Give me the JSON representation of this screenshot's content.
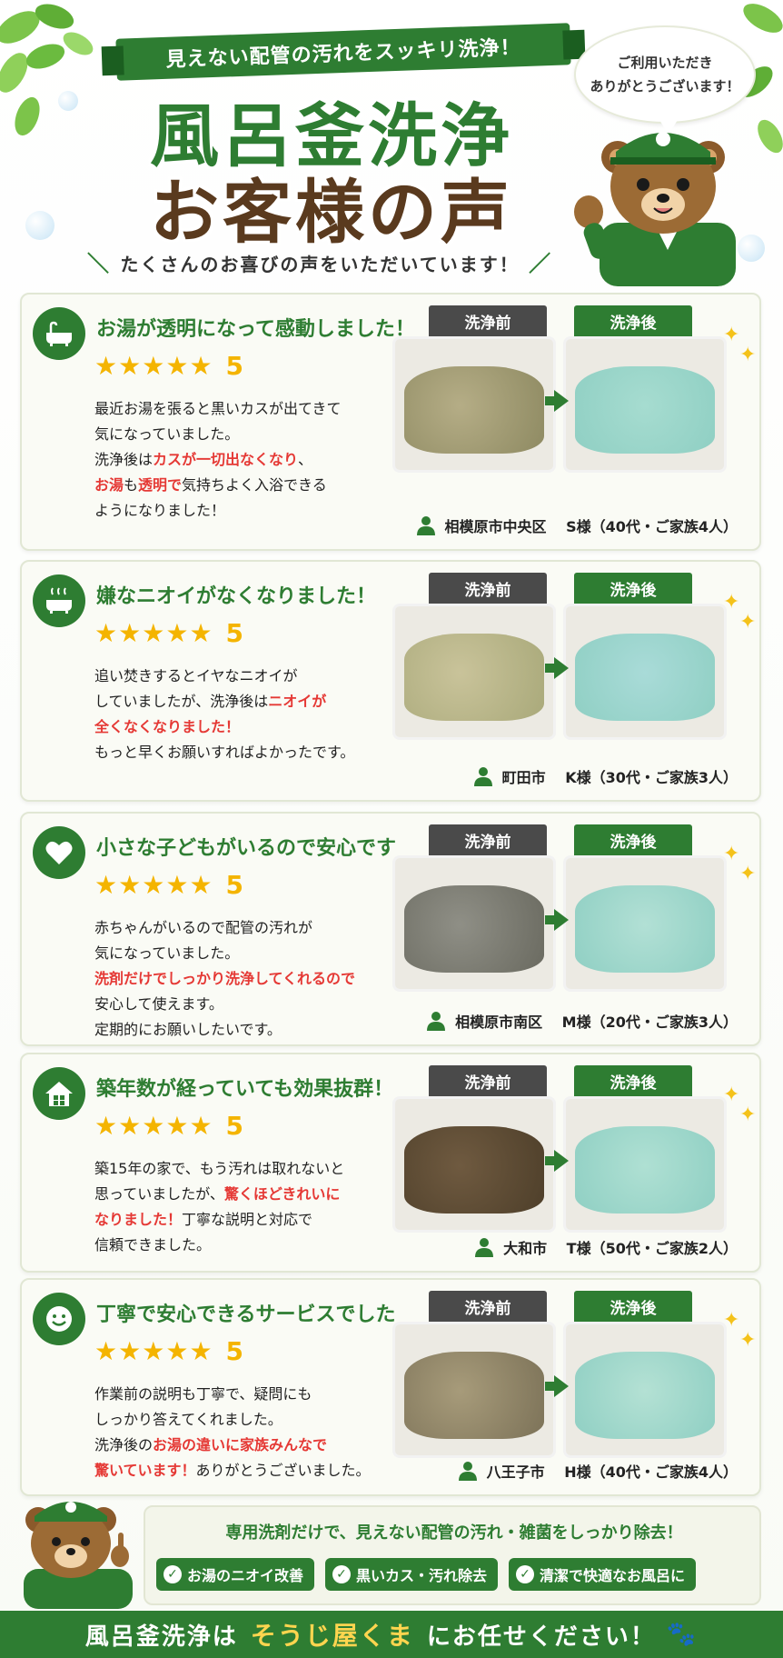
{
  "header": {
    "banner": "見えない配管の汚れをスッキリ洗浄！",
    "title_line1": "風呂釜洗浄",
    "title_line2": "お客様の声",
    "subtitle": "たくさんのお喜びの声をいただいています！",
    "speech_line1": "ご利用いただき",
    "speech_line2": "ありがとうございます！"
  },
  "photo_labels": {
    "before": "洗浄前",
    "after": "洗浄後"
  },
  "rating_star": "★",
  "reviews": [
    {
      "icon": "bathtub-icon",
      "title": "お湯が透明になって感動しました！",
      "rating": "5",
      "parts": [
        {
          "t": "最近お湯を張ると黒いカスが出てきて\n気になっていました。\n洗浄後は",
          "h": false
        },
        {
          "t": "カスが一切出なくなり",
          "h": true
        },
        {
          "t": "、\n",
          "h": false
        },
        {
          "t": "お湯",
          "h": true
        },
        {
          "t": "も",
          "h": false
        },
        {
          "t": "透明で",
          "h": true
        },
        {
          "t": "気持ちよく入浴できる\nようになりました！",
          "h": false
        }
      ],
      "customer": "相模原市中央区　 S様（40代・ご家族4人）"
    },
    {
      "icon": "steaming-bathtub-icon",
      "title": "嫌なニオイがなくなりました！",
      "rating": "5",
      "parts": [
        {
          "t": "追い焚きするとイヤなニオイが\nしていましたが、洗浄後は",
          "h": false
        },
        {
          "t": "ニオイが\n全くなくなりました！",
          "h": true
        },
        {
          "t": "\nもっと早くお願いすればよかったです。",
          "h": false
        }
      ],
      "customer": "町田市　 K様（30代・ご家族3人）"
    },
    {
      "icon": "heart-icon",
      "title": "小さな子どもがいるので安心です",
      "rating": "5",
      "parts": [
        {
          "t": "赤ちゃんがいるので配管の汚れが\n気になっていました。\n",
          "h": false
        },
        {
          "t": "洗剤だけでしっかり洗浄してくれるので",
          "h": true
        },
        {
          "t": "\n安心して使えます。\n定期的にお願いしたいです。",
          "h": false
        }
      ],
      "customer": "相模原市南区　 M様（20代・ご家族3人）"
    },
    {
      "icon": "house-icon",
      "title": "築年数が経っていても効果抜群！",
      "rating": "5",
      "parts": [
        {
          "t": "築15年の家で、もう汚れは取れないと\n思っていましたが、",
          "h": false
        },
        {
          "t": "驚くほどきれいに\nなりました！",
          "h": true
        },
        {
          "t": "丁寧な説明と対応で\n信頼できました。",
          "h": false
        }
      ],
      "customer": "大和市　 T様（50代・ご家族2人）"
    },
    {
      "icon": "smile-icon",
      "title": "丁寧で安心できるサービスでした",
      "rating": "5",
      "parts": [
        {
          "t": "作業前の説明も丁寧で、疑問にも\nしっかり答えてくれました。\n洗浄後の",
          "h": false
        },
        {
          "t": "お湯の違いに家族みんなで\n驚いています！",
          "h": true
        },
        {
          "t": "ありがとうございました。",
          "h": false
        }
      ],
      "customer": "八王子市　 H様（40代・ご家族4人）"
    }
  ],
  "promo": {
    "title": "専用洗剤だけで、見えない配管の汚れ・雑菌をしっかり除去！",
    "chips": [
      "お湯のニオイ改善",
      "黒いカス・汚れ除去",
      "清潔で快適なお風呂に"
    ]
  },
  "footer": {
    "prefix": "風呂釜洗浄は",
    "brand": "そうじ屋くま",
    "suffix": "にお任せください！"
  },
  "colors": {
    "green": "#2e7d32",
    "brown": "#5a3a1e",
    "star": "#f4b400",
    "highlight": "#e53935",
    "before_label": "#4a4a4a"
  }
}
